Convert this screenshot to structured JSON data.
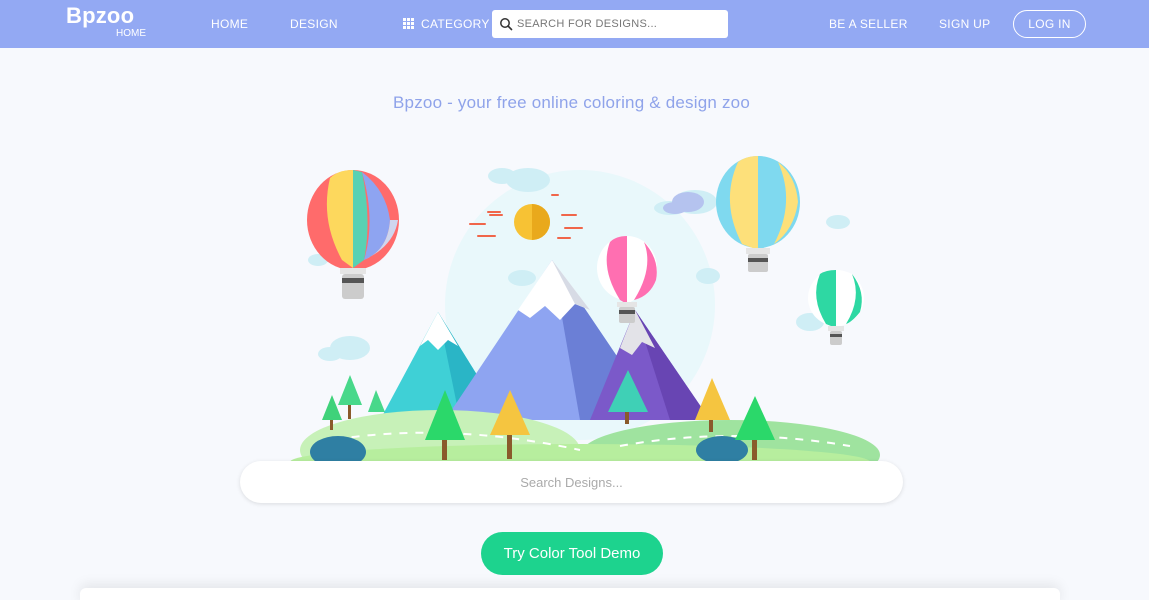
{
  "nav": {
    "logo": "Bpzoo",
    "logo_sub": "HOME",
    "home": "HOME",
    "design": "DESIGN",
    "category": "CATEGORY",
    "search_placeholder": "SEARCH FOR DESIGNS...",
    "be_seller": "BE A SELLER",
    "sign_up": "SIGN UP",
    "log_in": "LOG IN"
  },
  "hero": {
    "tagline": "Bpzoo - your free online coloring & design zoo",
    "search_placeholder": "Search Designs...",
    "demo_button": "Try Color Tool Demo"
  },
  "colors": {
    "nav_bg": "#93a9f3",
    "tagline": "#8fa3ea",
    "cta": "#1dd38e",
    "page_bg": "#f7f9fd"
  },
  "icons": [
    "category-grid-icon",
    "search-icon",
    "hot-air-balloon-illustration"
  ]
}
